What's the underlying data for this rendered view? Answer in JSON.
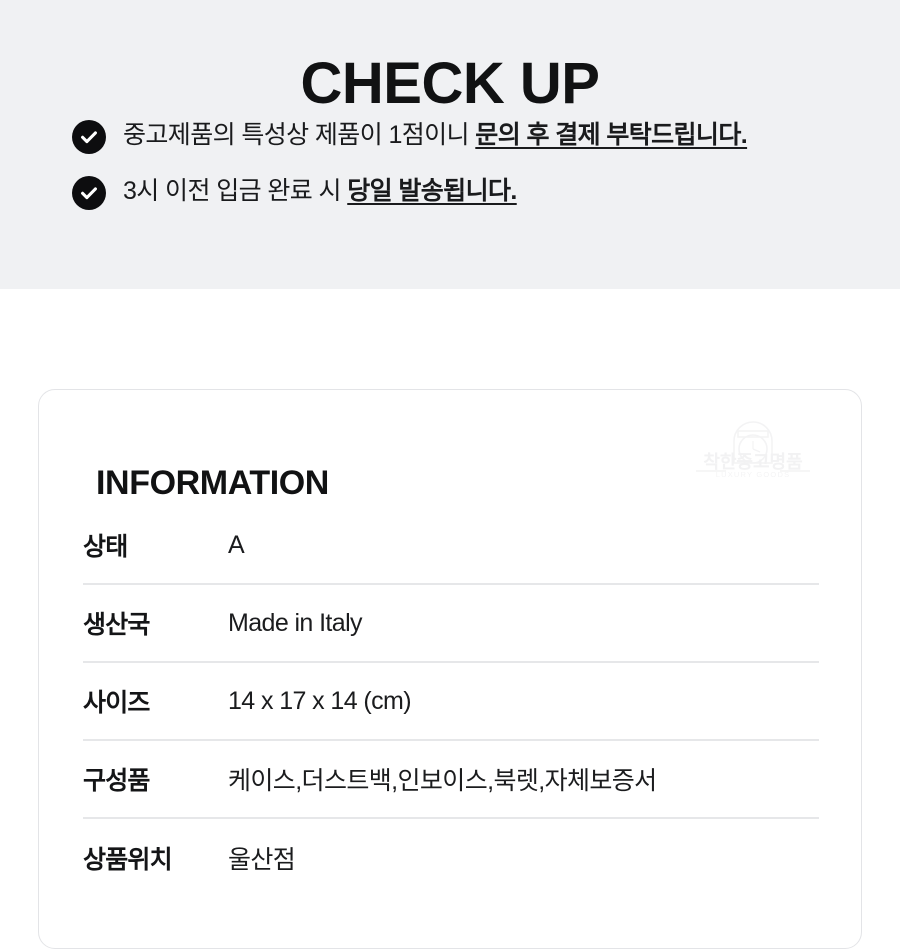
{
  "checkup": {
    "title": "CHECK UP",
    "items": [
      {
        "icon": "check-circle-icon",
        "text_plain": "중고제품의 특성상 제품이 1점이니 ",
        "text_emphasis": "문의 후 결제 부탁드립니다."
      },
      {
        "icon": "check-circle-icon",
        "text_plain": "3시 이전 입금 완료 시 ",
        "text_emphasis": "당일 발송됩니다."
      }
    ]
  },
  "information": {
    "heading": "INFORMATION",
    "watermark": {
      "icon": "watch-logo-icon",
      "brand": "착한중고명품",
      "tagline": "LUXURY GOODS"
    },
    "rows": [
      {
        "label": "상태",
        "value": "A"
      },
      {
        "label": "생산국",
        "value": "Made in Italy"
      },
      {
        "label": "사이즈",
        "value": "14 x 17 x 14 (cm)"
      },
      {
        "label": "구성품",
        "value": "케이스,더스트백,인보이스,북렛,자체보증서"
      },
      {
        "label": "상품위치",
        "value": "울산점"
      }
    ]
  },
  "colors": {
    "panel_background": "#f0f1f3",
    "page_background": "#ffffff",
    "text_primary": "#111213",
    "icon_fill": "#0d0d0f",
    "card_border": "#e3e4e7",
    "row_divider": "#e6e7e9",
    "watermark": "#f4f4f5"
  }
}
